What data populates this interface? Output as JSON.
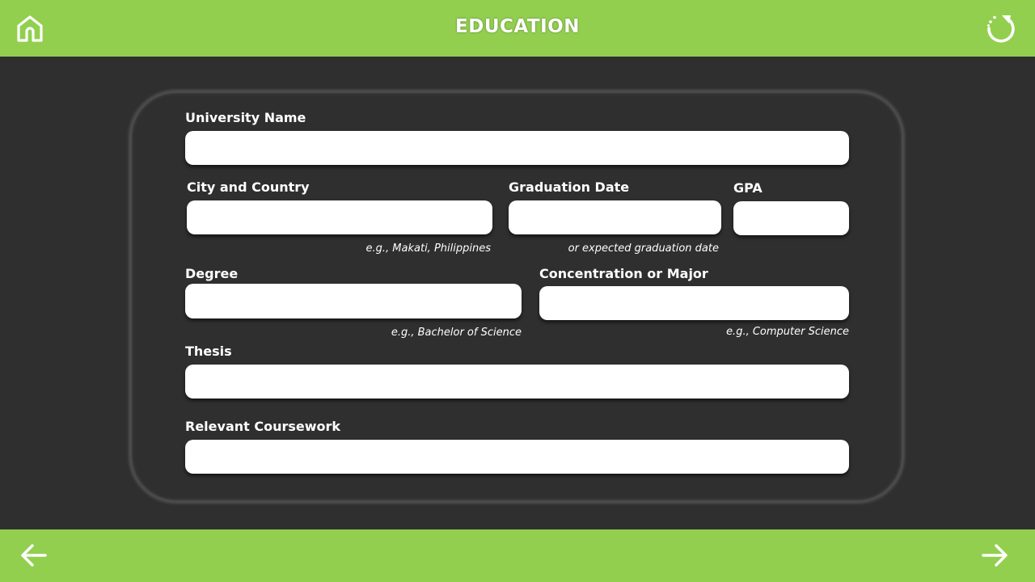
{
  "header": {
    "title": "EDUCATION",
    "home_icon": "home-icon",
    "reset_icon": "reset-icon"
  },
  "colors": {
    "accent": "#92cf4f",
    "background": "#2f2f2f",
    "field": "#ffffff",
    "text": "#ffffff"
  },
  "form": {
    "university_name": {
      "label": "University Name",
      "value": ""
    },
    "city_country": {
      "label": "City and Country",
      "value": "",
      "hint": "e.g., Makati, Philippines"
    },
    "graduation_date": {
      "label": "Graduation Date",
      "value": "",
      "hint": "or expected graduation date"
    },
    "gpa": {
      "label": "GPA",
      "value": ""
    },
    "degree": {
      "label": "Degree",
      "value": "",
      "hint": "e.g., Bachelor of Science"
    },
    "major": {
      "label": "Concentration or Major",
      "value": "",
      "hint": "e.g., Computer Science"
    },
    "thesis": {
      "label": "Thesis",
      "value": ""
    },
    "coursework": {
      "label": "Relevant Coursework",
      "value": ""
    }
  },
  "footer": {
    "back_icon": "arrow-left-icon",
    "next_icon": "arrow-right-icon"
  }
}
